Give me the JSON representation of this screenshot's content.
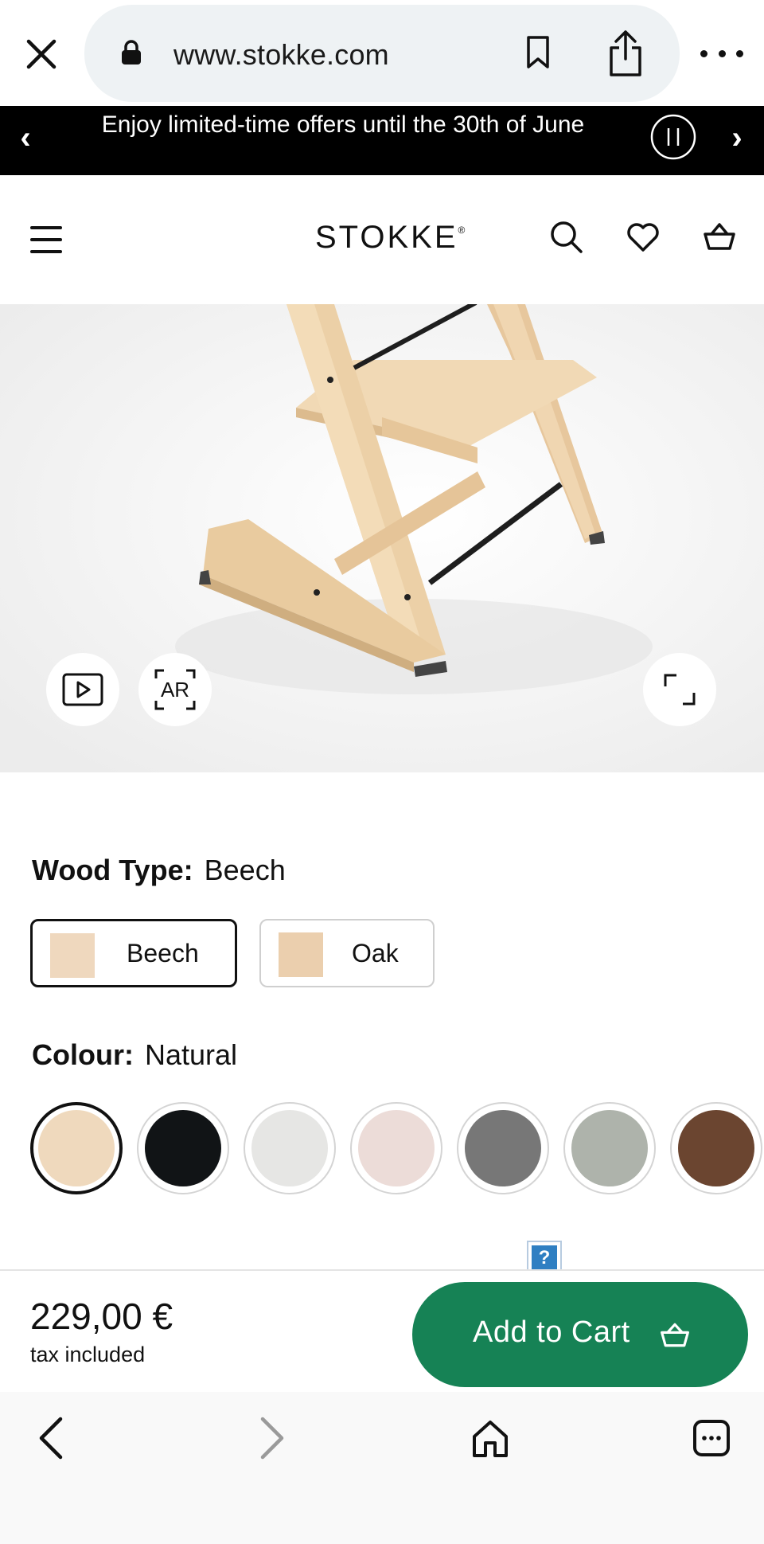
{
  "browser": {
    "url": "www.stokke.com"
  },
  "promo": {
    "text": "Enjoy limited-time offers until the 30th of June",
    "prev": "‹",
    "next": "›"
  },
  "header": {
    "logo": "STOKKE",
    "logo_mark": "®"
  },
  "media": {
    "ar_label": "AR"
  },
  "wood": {
    "label": "Wood Type:",
    "selected": "Beech",
    "options": [
      {
        "label": "Beech",
        "swatch": "#efd8be"
      },
      {
        "label": "Oak",
        "swatch": "#ebcfae"
      }
    ]
  },
  "colour": {
    "label": "Colour:",
    "selected": "Natural",
    "swatches": [
      {
        "color": "#efd9bd"
      },
      {
        "color": "#111416"
      },
      {
        "color": "#e6e6e4"
      },
      {
        "color": "#ecdcd8"
      },
      {
        "color": "#777777"
      },
      {
        "color": "#aeb3ab"
      },
      {
        "color": "#6b4530"
      }
    ]
  },
  "help": "?",
  "cart": {
    "price": "229,00 €",
    "tax_note": "tax included",
    "button_label": "Add to Cart",
    "button_color": "#168255"
  }
}
